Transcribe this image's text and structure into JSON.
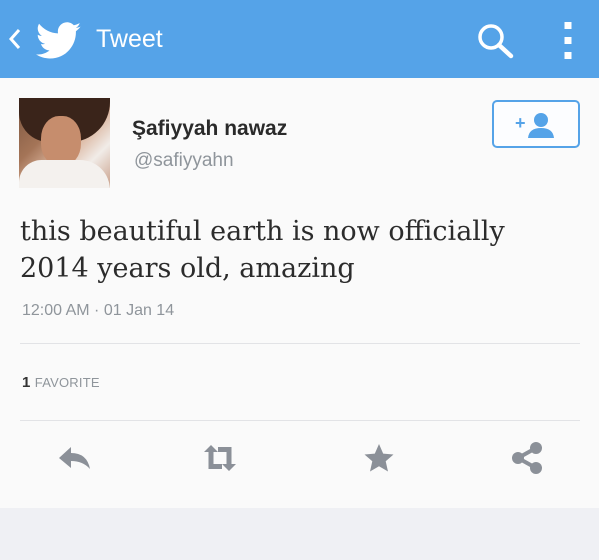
{
  "topbar": {
    "title": "Tweet",
    "icons": [
      "back-chevron-icon",
      "twitter-bird-icon",
      "search-icon",
      "more-vertical-icon"
    ]
  },
  "tweet": {
    "display_name": "Şafiyyah nawaz",
    "handle": "@safiyyahn",
    "text_line_1": "this beautiful earth is now officially",
    "text_line_2": "2014 years old, amazing",
    "timestamp": "12:00 AM · 01 Jan 14",
    "favorites_count": "1",
    "favorites_label": "FAVORITE"
  },
  "actions": [
    "reply-icon",
    "retweet-icon",
    "favorite-star-icon",
    "share-icon"
  ],
  "colors": {
    "topbar": "#55a3e8",
    "accent": "#55a3e8",
    "action_icon": "#8b9098",
    "text": "#2c2c2c",
    "muted": "#8f959b"
  }
}
